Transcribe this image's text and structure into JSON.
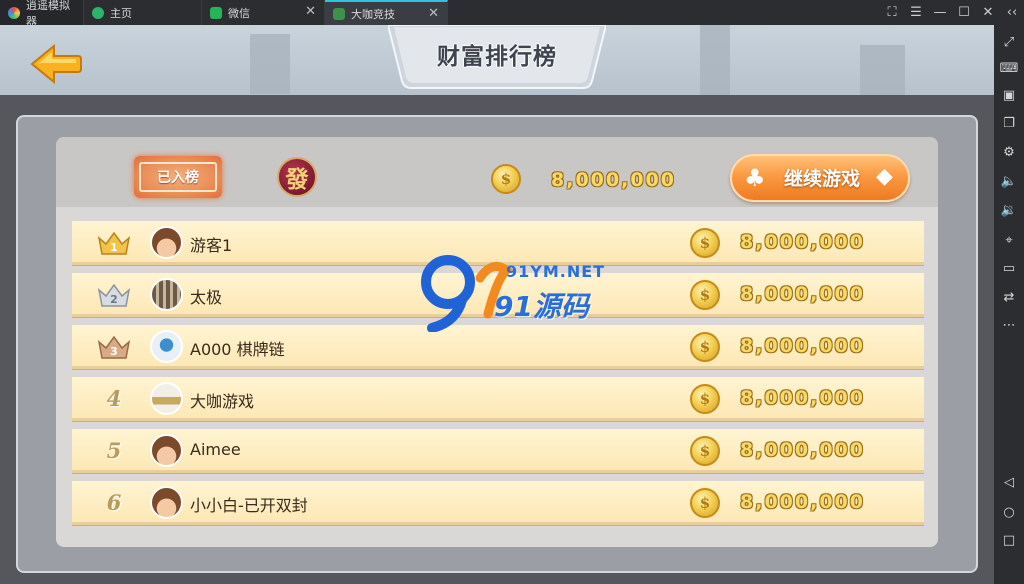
{
  "emulator": {
    "app_name": "逍遥模拟器",
    "tabs": [
      {
        "label": "主页"
      },
      {
        "label": "微信"
      },
      {
        "label": "大咖竞技"
      }
    ]
  },
  "game": {
    "title": "财富排行榜",
    "joined_label": "已入榜",
    "fa_glyph": "發",
    "my_coins": "8,000,000",
    "continue_label": "继续游戏",
    "coin_glyph": "$",
    "ranking": [
      {
        "rank": "1",
        "name": "游客1",
        "coins": "8,000,000"
      },
      {
        "rank": "2",
        "name": "太极",
        "coins": "8,000,000"
      },
      {
        "rank": "3",
        "name": "A000 棋牌链",
        "coins": "8,000,000"
      },
      {
        "rank": "4",
        "name": "大咖游戏",
        "coins": "8,000,000"
      },
      {
        "rank": "5",
        "name": "Aimee",
        "coins": "8,000,000"
      },
      {
        "rank": "6",
        "name": "小小白-已开双封",
        "coins": "8,000,000"
      }
    ]
  },
  "watermark": {
    "url": "91YM.NET",
    "text": "91源码"
  },
  "colors": {
    "accent_orange": "#f4902f",
    "gold": "#f6d86b",
    "row_bg": "#fde8b6"
  }
}
